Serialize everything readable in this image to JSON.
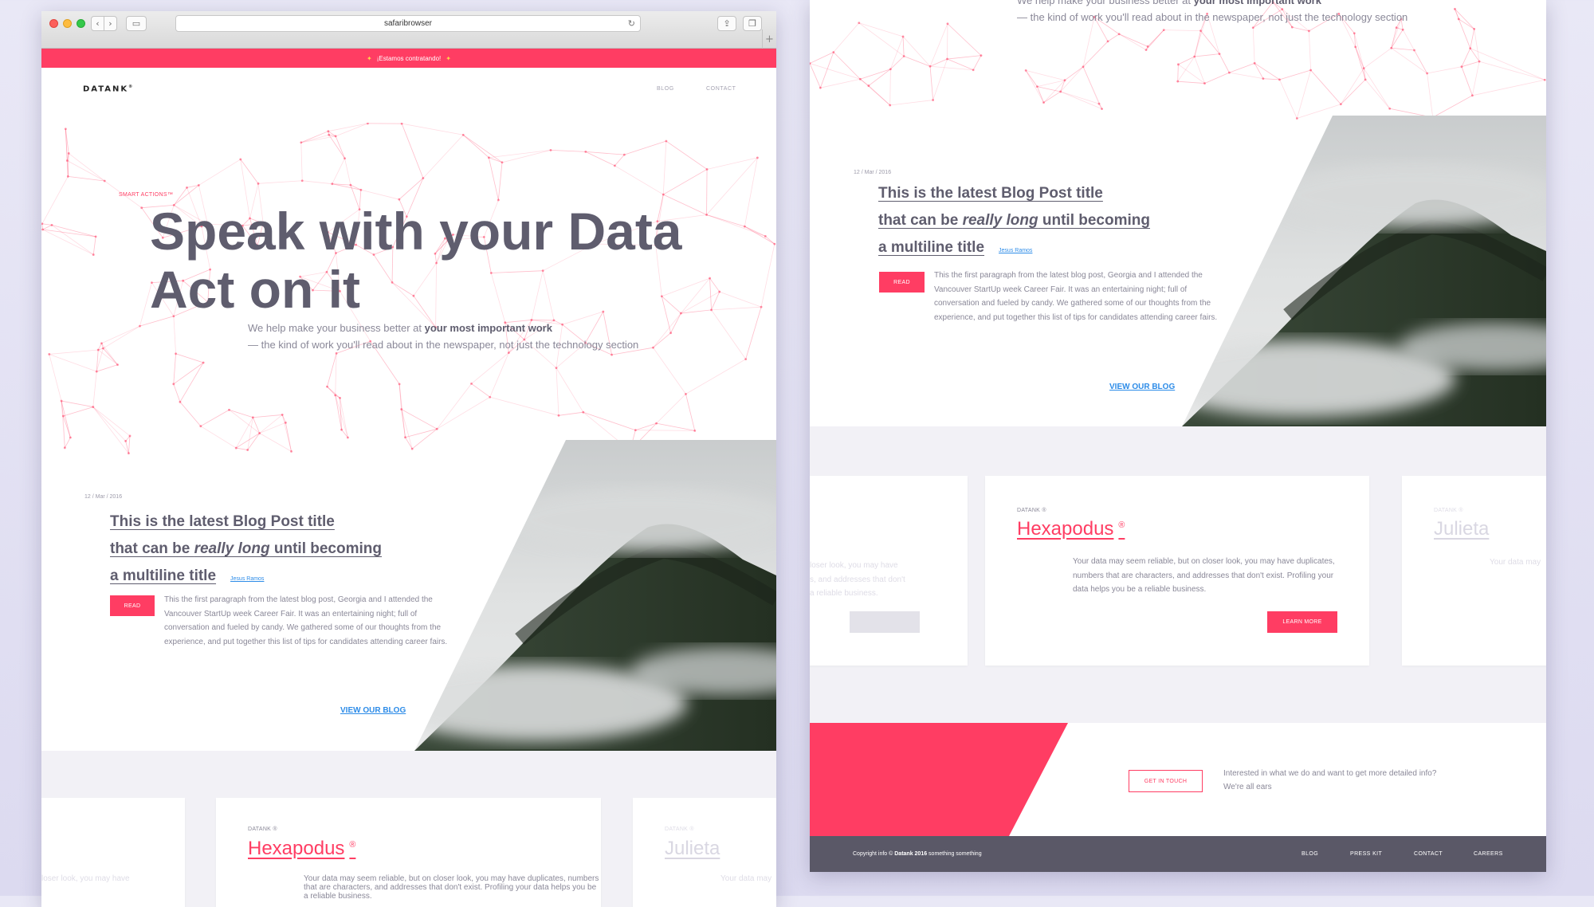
{
  "browser": {
    "address": "safaribrowser",
    "icons": [
      "back-icon",
      "forward-icon",
      "sidebar-icon",
      "reload-icon",
      "share-icon",
      "tabs-icon",
      "new-tab-icon"
    ]
  },
  "site": {
    "hiring_text": "¡Estamos contratando!",
    "logo": "DATANK",
    "logo_mark": "®",
    "nav": [
      "BLOG",
      "CONTACT"
    ]
  },
  "hero": {
    "eyebrow": "SMART ACTIONS™",
    "title_line1": "Speak with your Data",
    "title_line2": "Act on it",
    "sub_line1_plain": "We help make your business better at ",
    "sub_line1_bold": "your most important work",
    "sub_line2": "— the kind of work you'll read about in the newspaper, not just the technology section"
  },
  "blog": {
    "date": "12 / Mar / 2016",
    "title_line1": "This is the latest Blog Post title",
    "title_line2_a": "that can be ",
    "title_line2_em": "really long",
    "title_line2_b": " until becoming",
    "title_line3": "a multiline title",
    "author": "Jesus Ramos",
    "read_label": "READ",
    "paragraph": "This the first paragraph from the latest blog post, Georgia and I attended the Vancouver StartUp week Career Fair. It was an entertaining night; full of conversation and fueled by candy. We gathered some of our thoughts from the experience, and put together this list of tips for candidates attending career fairs.",
    "view_blog": "VIEW OUR BLOG"
  },
  "cards": {
    "kicker": "DATANK ®",
    "main_title": "Hexapodus",
    "main_mark": "®",
    "main_text": "Your data may seem reliable, but on closer look, you may have duplicates, numbers that are characters, and addresses that don't exist. Profiling your data helps you be a reliable business.",
    "learn_more": "LEARN MORE",
    "next_title": "Julieta",
    "next_text": "Your data may",
    "prev_text_1": "loser look, you may have",
    "prev_text_2": "s, and addresses that don't",
    "prev_text_3": "a reliable business."
  },
  "cta": {
    "button": "GET IN TOUCH",
    "line1": "Interested in what we do and want to get more detailed info?",
    "line2": "We're all ears"
  },
  "footer": {
    "copy_a": "Copyright info © ",
    "copy_bold": "Datank 2016",
    "copy_b": " something something",
    "links": [
      "BLOG",
      "PRESS KIT",
      "CONTACT",
      "CAREERS"
    ]
  },
  "colors": {
    "accent": "#ff3d63",
    "text": "#5f5d6e",
    "muted": "#8a8898",
    "link": "#2d8ce8",
    "footer": "#5a5867",
    "card_area": "#f2f1f6"
  }
}
